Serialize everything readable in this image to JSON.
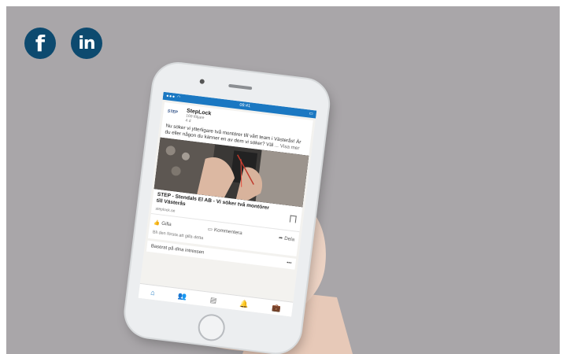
{
  "social": {
    "facebook_glyph": "f",
    "linkedin_glyph": "in",
    "color": "#0d4a6f"
  },
  "phone": {
    "status_time": "09:41",
    "post": {
      "company": "StepLock",
      "logo_text": "STEP",
      "followers": "169 följare",
      "age": "4 d",
      "body": "Nu söker vi ytterligare två montörer till vårt team i Västerås! Är du eller någon du känner en av dem vi söker? Väl",
      "more": "... Visa mer",
      "link_title": "STEP - Stendals El AB - Vi söker två montörer till Västerås",
      "link_domain": "steplock.se",
      "action_like": "Gilla",
      "action_comment": "Kommentera",
      "action_share": "Dela",
      "first_like": "Bli den första att gilla detta"
    },
    "feed_section": "Baserat på dina intressen",
    "tabs": [
      "home-icon",
      "network-icon",
      "messages-icon",
      "notifications-icon",
      "jobs-icon"
    ],
    "accent_color": "#1b78c2"
  }
}
